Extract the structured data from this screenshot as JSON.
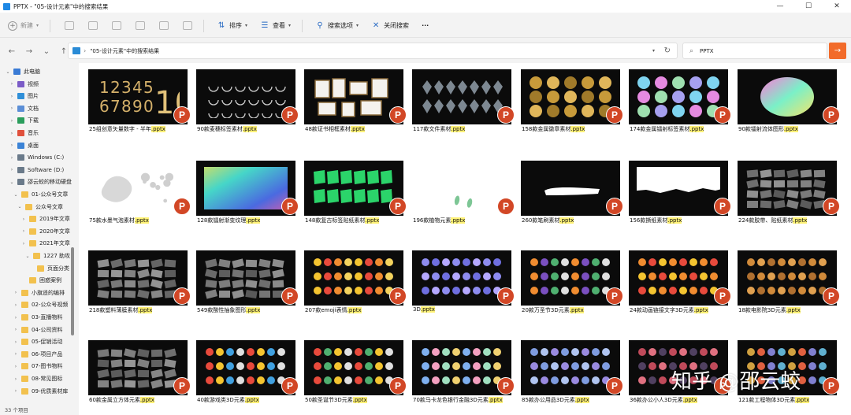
{
  "window": {
    "title": "PPTX - \"05-设计元素\"中的搜索结果",
    "minimize": "—",
    "maximize": "☐",
    "close": "✕"
  },
  "toolbar": {
    "new_label": "新建",
    "sort_label": "排序",
    "view_label": "查看",
    "search_options_label": "搜索选项",
    "close_search_label": "关闭搜索",
    "more_label": "···"
  },
  "address": {
    "path": "\"05-设计元素\"中的搜索结果",
    "search_value": "PPTX",
    "back": "←",
    "forward": "→",
    "recent": "⌄",
    "up": "↑"
  },
  "sidebar": {
    "items": [
      {
        "label": "此电脑",
        "icon": "computer-icon",
        "color": "#3a7bd5",
        "chev": "⌄",
        "indent": 0
      },
      {
        "label": "视频",
        "icon": "video-folder-icon",
        "color": "#7b5cc7",
        "chev": "›",
        "indent": 1
      },
      {
        "label": "图片",
        "icon": "picture-folder-icon",
        "color": "#2f8fd8",
        "chev": "›",
        "indent": 1
      },
      {
        "label": "文档",
        "icon": "document-folder-icon",
        "color": "#5b8ed6",
        "chev": "›",
        "indent": 1
      },
      {
        "label": "下载",
        "icon": "download-icon",
        "color": "#2a9d5c",
        "chev": "›",
        "indent": 1
      },
      {
        "label": "音乐",
        "icon": "music-icon",
        "color": "#e0503c",
        "chev": "›",
        "indent": 1
      },
      {
        "label": "桌面",
        "icon": "desktop-icon",
        "color": "#3b83d6",
        "chev": "›",
        "indent": 1
      },
      {
        "label": "Windows (C:)",
        "icon": "drive-icon",
        "color": "#6a7a8a",
        "chev": "›",
        "indent": 1
      },
      {
        "label": "Software (D:)",
        "icon": "drive-icon",
        "color": "#6a7a8a",
        "chev": "›",
        "indent": 1
      },
      {
        "label": "邵云蛟的移动硬盘",
        "icon": "drive-icon",
        "color": "#6a7a8a",
        "chev": "⌄",
        "indent": 1
      },
      {
        "label": "01-公众号文章",
        "icon": "folder-icon",
        "color": "#f2c14e",
        "chev": "⌄",
        "indent": 2
      },
      {
        "label": "公众号文章",
        "icon": "folder-icon",
        "color": "#f2c14e",
        "chev": "⌄",
        "indent": 3
      },
      {
        "label": "2019年文章",
        "icon": "folder-icon",
        "color": "#f2c14e",
        "chev": "›",
        "indent": 4
      },
      {
        "label": "2020年文章",
        "icon": "folder-icon",
        "color": "#f2c14e",
        "chev": "›",
        "indent": 4
      },
      {
        "label": "2021年文章",
        "icon": "folder-icon",
        "color": "#f2c14e",
        "chev": "›",
        "indent": 4
      },
      {
        "label": "1227 助攻",
        "icon": "folder-icon",
        "color": "#f2c14e",
        "chev": "⌄",
        "indent": 5
      },
      {
        "label": "页面分类",
        "icon": "folder-icon",
        "color": "#f2c14e",
        "chev": "",
        "indent": 6
      },
      {
        "label": "困惑案例",
        "icon": "folder-icon",
        "color": "#f2c14e",
        "chev": "",
        "indent": 4
      },
      {
        "label": "小旗遥的编排",
        "icon": "folder-icon",
        "color": "#f2c14e",
        "chev": "›",
        "indent": 2
      },
      {
        "label": "02-公众号视频",
        "icon": "folder-icon",
        "color": "#f2c14e",
        "chev": "›",
        "indent": 2
      },
      {
        "label": "03-直播物料",
        "icon": "folder-icon",
        "color": "#f2c14e",
        "chev": "›",
        "indent": 2
      },
      {
        "label": "04-公司资料",
        "icon": "folder-icon",
        "color": "#f2c14e",
        "chev": "›",
        "indent": 2
      },
      {
        "label": "05-促销活动",
        "icon": "folder-icon",
        "color": "#f2c14e",
        "chev": "›",
        "indent": 2
      },
      {
        "label": "06-项目产品",
        "icon": "folder-icon",
        "color": "#f2c14e",
        "chev": "›",
        "indent": 2
      },
      {
        "label": "07-图书物料",
        "icon": "folder-icon",
        "color": "#f2c14e",
        "chev": "›",
        "indent": 2
      },
      {
        "label": "08-常见图标",
        "icon": "folder-icon",
        "color": "#f2c14e",
        "chev": "›",
        "indent": 2
      },
      {
        "label": "09-优质素材库",
        "icon": "folder-icon",
        "color": "#f2c14e",
        "chev": "›",
        "indent": 2
      }
    ]
  },
  "status": {
    "item_count": "33 个项目"
  },
  "files": [
    {
      "name": "25组创意矢量数字 - 半年",
      "ext": ".pptx",
      "art": "gold-digits",
      "bg": "#0b0b0b"
    },
    {
      "name": "90款麦穗标签素材",
      "ext": ".pptx",
      "art": "laurels",
      "bg": "#0b0b0b"
    },
    {
      "name": "48款证书相框素材",
      "ext": ".pptx",
      "art": "frames",
      "bg": "#0b0b0b"
    },
    {
      "name": "117款文件素材",
      "ext": ".pptx",
      "art": "glass",
      "bg": "#0b0b0b"
    },
    {
      "name": "158款金属徽章素材",
      "ext": ".pptx",
      "art": "gold-badges",
      "bg": "#0b0b0b"
    },
    {
      "name": "174款金属镭射标签素材",
      "ext": ".pptx",
      "art": "holo-badges",
      "bg": "#0b0b0b"
    },
    {
      "name": "90款镭射流体图形",
      "ext": ".pptx",
      "art": "holo-blob",
      "bg": "#0b0b0b"
    },
    {
      "name": "75款水墨气泡素材",
      "ext": ".pptx",
      "art": "water",
      "bg": "#ffffff"
    },
    {
      "name": "128款镭射渐变纹理",
      "ext": ".pptx",
      "art": "gradient",
      "bg": "#0b0b0b"
    },
    {
      "name": "148款复古标签贴纸素材",
      "ext": ".pptx",
      "art": "green-paper",
      "bg": "#0b0b0b"
    },
    {
      "name": "196款植物元素",
      "ext": ".pptx",
      "art": "plants",
      "bg": "#ffffff"
    },
    {
      "name": "260款笔刷素材",
      "ext": ".pptx",
      "art": "brush",
      "bg": "#0b0b0b"
    },
    {
      "name": "156款撕纸素材",
      "ext": ".pptx",
      "art": "torn",
      "bg": "#0b0b0b"
    },
    {
      "name": "224款胶带、贴纸素材",
      "ext": ".pptx",
      "art": "tape",
      "bg": "#0b0b0b"
    },
    {
      "name": "218款塑料薄膜素材",
      "ext": ".pptx",
      "art": "plastic",
      "bg": "#0b0b0b"
    },
    {
      "name": "549款酸性抽象图形",
      "ext": ".pptx",
      "art": "acid",
      "bg": "#0b0b0b"
    },
    {
      "name": "207款emoji表情",
      "ext": ".pptx",
      "art": "emoji",
      "bg": "#0b0b0b"
    },
    {
      "name": "3D",
      "ext": ".pptx",
      "art": "3d-icons",
      "bg": "#0b0b0b"
    },
    {
      "name": "20款万圣节3D元素",
      "ext": ".pptx",
      "art": "halloween",
      "bg": "#0b0b0b"
    },
    {
      "name": "24款动画链接文字3D元素",
      "ext": ".pptx",
      "art": "comic",
      "bg": "#0b0b0b"
    },
    {
      "name": "18款电影院3D元素",
      "ext": ".pptx",
      "art": "cinema",
      "bg": "#0b0b0b"
    },
    {
      "name": "60款金属立方体元素",
      "ext": ".pptx",
      "art": "metal",
      "bg": "#0b0b0b"
    },
    {
      "name": "40款游戏类3D元素",
      "ext": ".pptx",
      "art": "game",
      "bg": "#0b0b0b"
    },
    {
      "name": "50款圣诞节3D元素",
      "ext": ".pptx",
      "art": "xmas",
      "bg": "#0b0b0b"
    },
    {
      "name": "70款马卡龙色银行金融3D元素",
      "ext": ".pptx",
      "art": "finance",
      "bg": "#0b0b0b"
    },
    {
      "name": "85款办公用品3D元素",
      "ext": ".pptx",
      "art": "office",
      "bg": "#0b0b0b"
    },
    {
      "name": "36款办公小人3D元素",
      "ext": ".pptx",
      "art": "people",
      "bg": "#0b0b0b"
    },
    {
      "name": "121款工程物体3D元素",
      "ext": ".pptx",
      "art": "engineering",
      "bg": "#0b0b0b"
    }
  ],
  "badge_letter": "P",
  "watermark": "知乎 @邵云蛟",
  "colors": {
    "accent": "#f26b2a",
    "ppt_red": "#d24726",
    "highlight": "#fff176"
  }
}
